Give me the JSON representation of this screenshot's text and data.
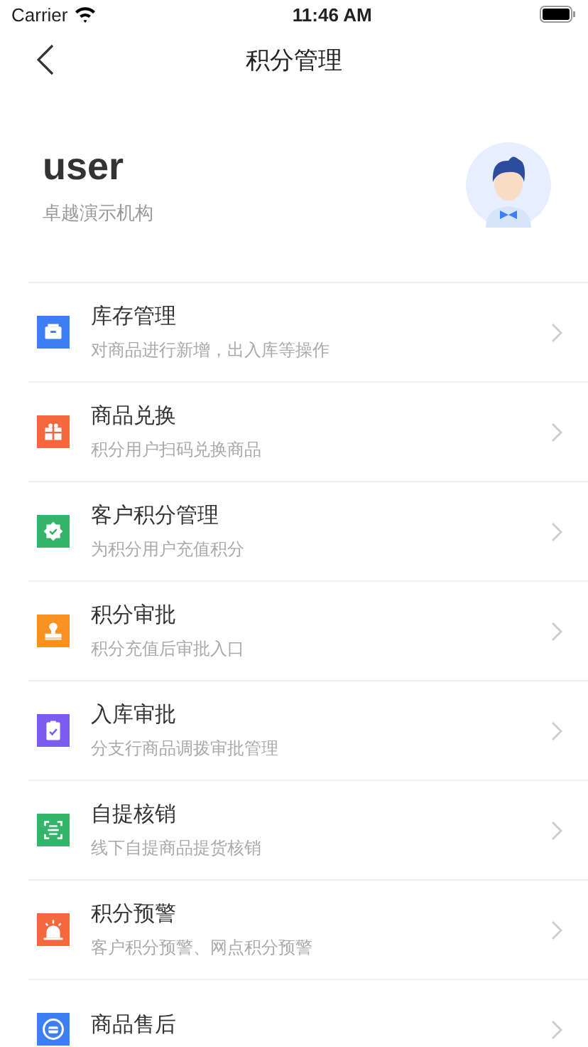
{
  "status_bar": {
    "carrier": "Carrier",
    "time": "11:46 AM"
  },
  "nav": {
    "title": "积分管理"
  },
  "profile": {
    "name": "user",
    "organization": "卓越演示机构"
  },
  "menu": [
    {
      "title": "库存管理",
      "subtitle": "对商品进行新增，出入库等操作",
      "color": "#3d7ef5"
    },
    {
      "title": "商品兑换",
      "subtitle": "积分用户扫码兑换商品",
      "color": "#f4673f"
    },
    {
      "title": "客户积分管理",
      "subtitle": "为积分用户充值积分",
      "color": "#35b36b"
    },
    {
      "title": "积分审批",
      "subtitle": "积分充值后审批入口",
      "color": "#fa9222"
    },
    {
      "title": "入库审批",
      "subtitle": "分支行商品调拨审批管理",
      "color": "#7a5cf0"
    },
    {
      "title": "自提核销",
      "subtitle": "线下自提商品提货核销",
      "color": "#35b36b"
    },
    {
      "title": "积分预警",
      "subtitle": "客户积分预警、网点积分预警",
      "color": "#f4673f"
    },
    {
      "title": "商品售后",
      "color": "#3d7ef5"
    }
  ]
}
